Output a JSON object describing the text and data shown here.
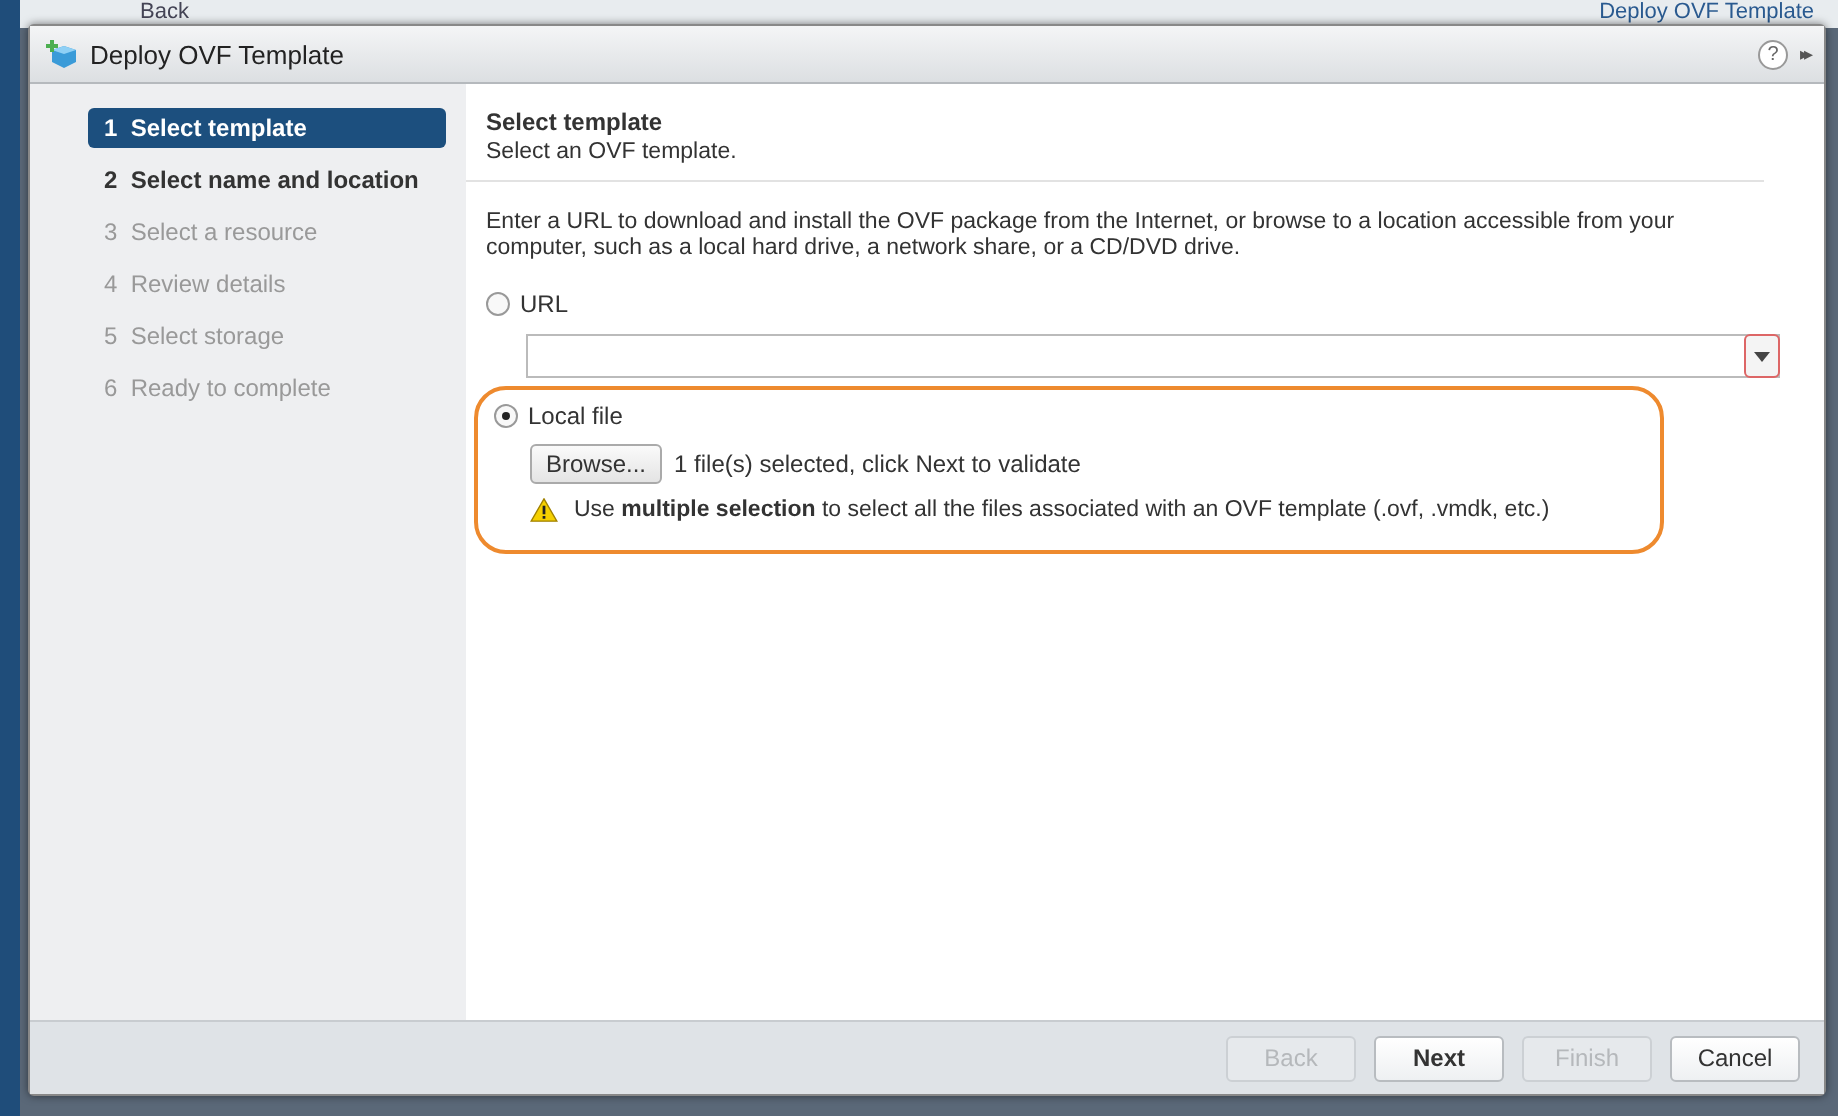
{
  "background": {
    "back_label": "Back",
    "window_title": "Deploy OVF Template"
  },
  "window": {
    "title": "Deploy OVF Template",
    "help": "?",
    "collapse": "▸▸"
  },
  "steps": [
    {
      "number": "1",
      "label": "Select template",
      "selected": true,
      "enabled": true
    },
    {
      "number": "2",
      "label": "Select name and location",
      "selected": false,
      "enabled": true
    },
    {
      "number": "3",
      "label": "Select a resource",
      "selected": false,
      "enabled": false
    },
    {
      "number": "4",
      "label": "Review details",
      "selected": false,
      "enabled": false
    },
    {
      "number": "5",
      "label": "Select storage",
      "selected": false,
      "enabled": false
    },
    {
      "number": "6",
      "label": "Ready to complete",
      "selected": false,
      "enabled": false
    }
  ],
  "page": {
    "title": "Select template",
    "subtitle": "Select an OVF template.",
    "intro": "Enter a URL to download and install the OVF package from the Internet, or browse to a location accessible from your computer, such as a local hard drive, a network share, or a CD/DVD drive.",
    "url_option": {
      "label": "URL",
      "selected": false
    },
    "local_option": {
      "label": "Local file",
      "selected": true,
      "highlighted": true
    },
    "browse_button": "Browse...",
    "file_status": "1 file(s) selected, click Next to validate",
    "warning": "Use **multiple selection** to select all the files associated with an OVF template (.ovf, .vmdk, etc.)"
  },
  "buttons": [
    {
      "label": "Back",
      "disabled": true,
      "primary": false
    },
    {
      "label": "Next",
      "disabled": false,
      "primary": true
    },
    {
      "label": "Finish",
      "disabled": true,
      "primary": false
    },
    {
      "label": "Cancel",
      "disabled": false,
      "primary": false
    }
  ]
}
